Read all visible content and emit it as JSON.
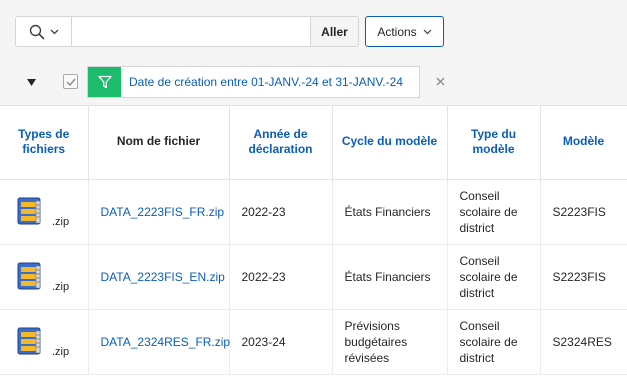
{
  "toolbar": {
    "search_icon": "search-icon",
    "search_value": "",
    "search_placeholder": "",
    "go_label": "Aller",
    "actions_label": "Actions",
    "accent_color": "#0b5eb5"
  },
  "filter": {
    "label": "Date de création entre 01-JANV.-24 et 31-JANV.-24",
    "icon": "filter-icon",
    "icon_bg_color": "#1dbb6c",
    "enabled": true
  },
  "table": {
    "headers": {
      "types": "Types de fichiers",
      "nom": "Nom de fichier",
      "annee": "Année de déclaration",
      "cycle": "Cycle du modèle",
      "type": "Type du modèle",
      "modele": "Modèle"
    },
    "rows": [
      {
        "ext": ".zip",
        "nom": "DATA_2223FIS_FR.zip",
        "annee": "2022-23",
        "cycle": "États Financiers",
        "type": "Conseil scolaire de district",
        "modele": "S2223FIS"
      },
      {
        "ext": ".zip",
        "nom": "DATA_2223FIS_EN.zip",
        "annee": "2022-23",
        "cycle": "États Financiers",
        "type": "Conseil scolaire de district",
        "modele": "S2223FIS"
      },
      {
        "ext": ".zip",
        "nom": "DATA_2324RES_FR.zip",
        "annee": "2023-24",
        "cycle": "Prévisions budgétaires révisées",
        "type": "Conseil scolaire de district",
        "modele": "S2324RES"
      }
    ]
  }
}
